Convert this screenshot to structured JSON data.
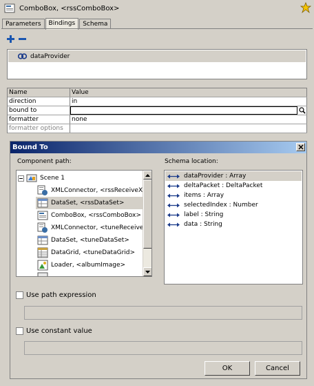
{
  "window": {
    "title": "ComboBox, <rssComboBox>"
  },
  "tabs": [
    {
      "label": "Parameters"
    },
    {
      "label": "Bindings"
    },
    {
      "label": "Schema"
    }
  ],
  "bindings": {
    "items": [
      {
        "label": "dataProvider"
      }
    ]
  },
  "properties": {
    "headers": {
      "name": "Name",
      "value": "Value"
    },
    "rows": [
      {
        "name": "direction",
        "value": "in"
      },
      {
        "name": "bound to",
        "value": ""
      },
      {
        "name": "formatter",
        "value": "none"
      },
      {
        "name": "formatter options",
        "value": ""
      }
    ]
  },
  "dialog": {
    "title": "Bound To",
    "component_path_label": "Component path:",
    "schema_location_label": "Schema location:",
    "tree": [
      {
        "label": "Scene 1",
        "icon": "scene-icon"
      },
      {
        "label": "XMLConnector, <rssReceiveXMl",
        "icon": "xmlconnector-icon"
      },
      {
        "label": "DataSet, <rssDataSet>",
        "icon": "dataset-icon"
      },
      {
        "label": "ComboBox, <rssComboBox>",
        "icon": "combobox-icon"
      },
      {
        "label": "XMLConnector, <tuneReceiveXl",
        "icon": "xmlconnector-icon"
      },
      {
        "label": "DataSet, <tuneDataSet>",
        "icon": "dataset-icon"
      },
      {
        "label": "DataGrid, <tuneDataGrid>",
        "icon": "datagrid-icon"
      },
      {
        "label": "Loader, <albumImage>",
        "icon": "loader-icon"
      }
    ],
    "schema": [
      {
        "label": "dataProvider : Array"
      },
      {
        "label": "deltaPacket : DeltaPacket"
      },
      {
        "label": "items : Array"
      },
      {
        "label": "selectedIndex : Number"
      },
      {
        "label": "label : String"
      },
      {
        "label": "data : String"
      }
    ],
    "use_path_expression": "Use path expression",
    "use_constant_value": "Use constant value",
    "ok": "OK",
    "cancel": "Cancel"
  }
}
